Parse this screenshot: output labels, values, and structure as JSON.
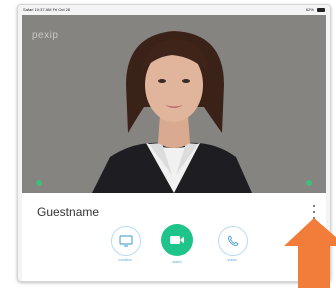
{
  "statusbar": {
    "left_text": "Safari  10:37 AM  Fri Oct 28",
    "right_text": "62%"
  },
  "video": {
    "watermark": "pexip"
  },
  "bottom": {
    "guest_name": "Guestname",
    "controls": [
      {
        "label": "content",
        "icon": "screen-share-icon"
      },
      {
        "label": "video",
        "icon": "camera-icon"
      },
      {
        "label": "voice",
        "icon": "phone-icon"
      }
    ]
  },
  "colors": {
    "accent": "#1ec48a",
    "icon_blue": "#5aa8d8",
    "arrow": "#f27c3a"
  }
}
